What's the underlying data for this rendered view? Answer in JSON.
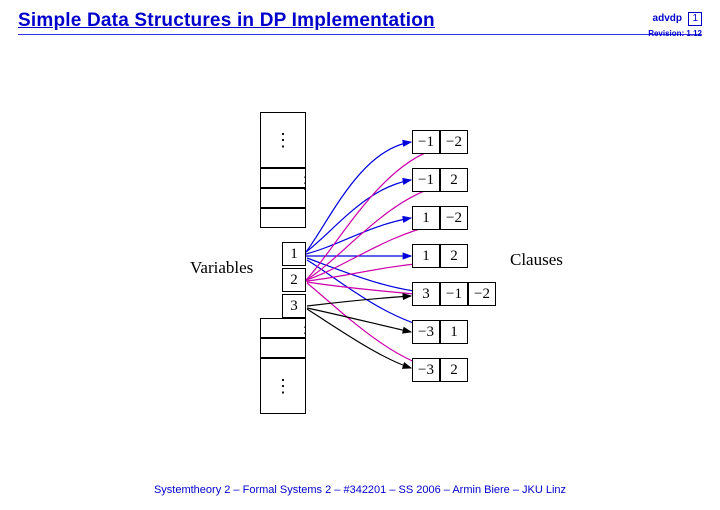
{
  "header": {
    "title": "Simple Data Structures in DP Implementation",
    "badge": "advdp",
    "page": "1",
    "revision": "Revision: 1.12"
  },
  "labels": {
    "variables": "Variables",
    "clauses": "Clauses"
  },
  "variables": {
    "v1": "1",
    "v2": "2",
    "v3": "3"
  },
  "clauses": {
    "c0": {
      "a": "−1",
      "b": "−2"
    },
    "c1": {
      "a": "−1",
      "b": "2"
    },
    "c2": {
      "a": "1",
      "b": "−2"
    },
    "c3": {
      "a": "1",
      "b": "2"
    },
    "c4": {
      "a": "3",
      "b": "−1",
      "c": "−2"
    },
    "c5": {
      "a": "−3",
      "b": "1"
    },
    "c6": {
      "a": "−3",
      "b": "2"
    }
  },
  "footer": "Systemtheory 2  –  Formal Systems 2  –  #342201  –  SS 2006 – Armin Biere – JKU Linz"
}
